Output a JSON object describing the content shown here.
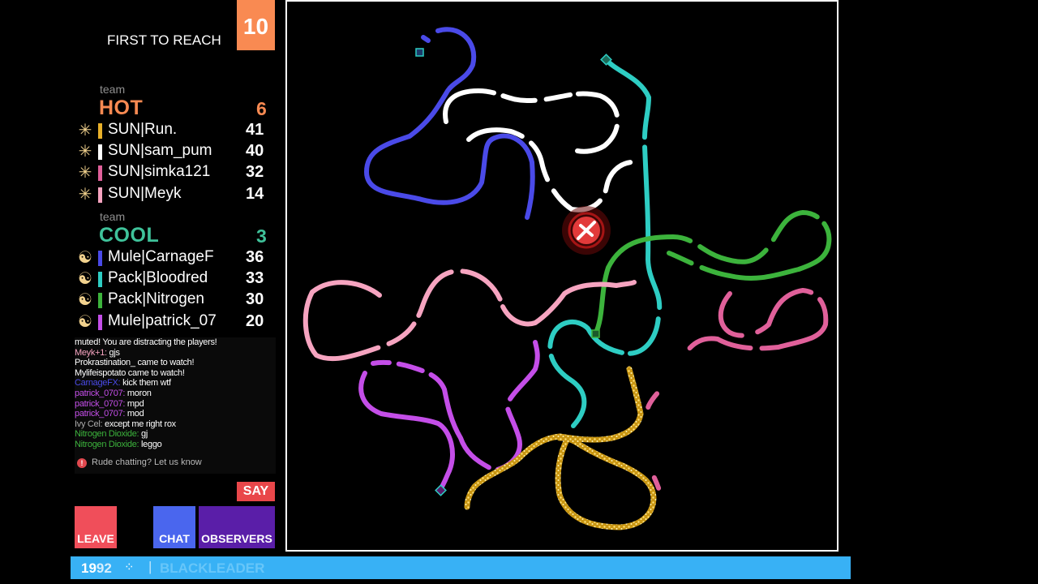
{
  "header": {
    "goal_label": "FIRST TO REACH",
    "goal_value": "10"
  },
  "teams": [
    {
      "tag": "team",
      "name": "HOT",
      "score": "6",
      "color": "#f98a52",
      "players": [
        {
          "name": "SUN|Run.",
          "score": "41",
          "bar_color": "#e8b02a",
          "icon": "snowflake-icon"
        },
        {
          "name": "SUN|sam_pum",
          "score": "40",
          "bar_color": "#ffffff",
          "icon": "snowflake-icon"
        },
        {
          "name": "SUN|simka121",
          "score": "32",
          "bar_color": "#e0609a",
          "icon": "snowflake-icon"
        },
        {
          "name": "SUN|Meyk",
          "score": "14",
          "bar_color": "#f6a4c0",
          "icon": "snowflake-icon"
        }
      ]
    },
    {
      "tag": "team",
      "name": "COOL",
      "score": "3",
      "color": "#3fc29a",
      "players": [
        {
          "name": "Mule|CarnageF",
          "score": "36",
          "bar_color": "#4a4ae8",
          "icon": "yinyang-icon"
        },
        {
          "name": "Pack|Bloodred",
          "score": "33",
          "bar_color": "#2ecdc3",
          "icon": "yinyang-icon"
        },
        {
          "name": "Pack|Nitrogen",
          "score": "30",
          "bar_color": "#3cb33c",
          "icon": "yinyang-icon"
        },
        {
          "name": "Mule|patrick_07",
          "score": "20",
          "bar_color": "#c44ee8",
          "icon": "yinyang-icon"
        }
      ]
    }
  ],
  "chat": [
    {
      "author": "",
      "text": "muted! You are distracting the players!",
      "color": "#ffffff"
    },
    {
      "author": "Meyk+1:",
      "text": " gjs",
      "color": "#f6a4c0"
    },
    {
      "author": "",
      "text": "Prokrastination_ came to watch!",
      "color": "#ffffff"
    },
    {
      "author": "",
      "text": "Mylifeispotato came to watch!",
      "color": "#ffffff"
    },
    {
      "author": "CarnageFX:",
      "text": " kick them wtf",
      "color": "#4a4ae8"
    },
    {
      "author": "patrick_0707:",
      "text": " moron",
      "color": "#c44ee8"
    },
    {
      "author": "patrick_0707:",
      "text": " mpd",
      "color": "#c44ee8"
    },
    {
      "author": "patrick_0707:",
      "text": " mod",
      "color": "#c44ee8"
    },
    {
      "author": "Ivy Cel:",
      "text": " except me right rox",
      "color": "#aaaaaa"
    },
    {
      "author": "Nitrogen Dioxide:",
      "text": " gj",
      "color": "#3cb33c"
    },
    {
      "author": "Nitrogen Dioxide:",
      "text": " leggo",
      "color": "#3cb33c"
    }
  ],
  "rude_notice": "Rude chatting? Let us know",
  "say_button": "SAY",
  "buttons": {
    "leave": "LEAVE",
    "chat": "CHAT",
    "observers": "OBSERVERS"
  },
  "bottom_bar": {
    "year_a": "19",
    "year_b": "92",
    "leader": "BLACKLEADER",
    "color": "#38b1f5"
  }
}
